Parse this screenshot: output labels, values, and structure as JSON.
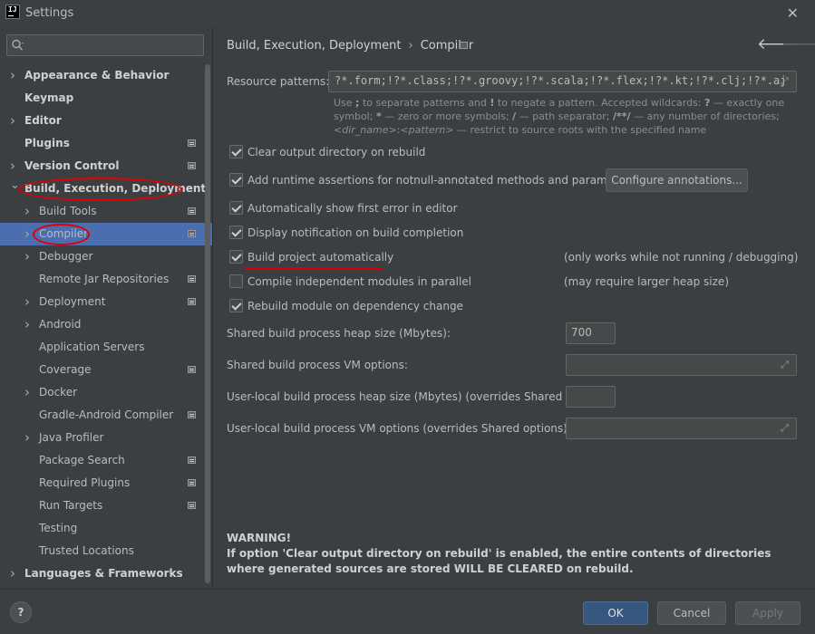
{
  "window": {
    "title": "Settings",
    "logo_text": "IJ"
  },
  "sidebar": {
    "search_placeholder": "",
    "items": [
      {
        "label": "Appearance & Behavior",
        "level": 0,
        "has_children": true,
        "has_icon": false
      },
      {
        "label": "Keymap",
        "level": 0,
        "has_children": false,
        "has_icon": false
      },
      {
        "label": "Editor",
        "level": 0,
        "has_children": true,
        "has_icon": false
      },
      {
        "label": "Plugins",
        "level": 0,
        "has_children": false,
        "has_icon": true
      },
      {
        "label": "Version Control",
        "level": 0,
        "has_children": true,
        "has_icon": true
      },
      {
        "label": "Build, Execution, Deployment",
        "level": 0,
        "has_children": true,
        "expanded": true,
        "has_icon": false
      },
      {
        "label": "Build Tools",
        "level": 1,
        "has_children": true,
        "has_icon": true
      },
      {
        "label": "Compiler",
        "level": 1,
        "has_children": true,
        "has_icon": true,
        "selected": true
      },
      {
        "label": "Debugger",
        "level": 1,
        "has_children": true,
        "has_icon": false
      },
      {
        "label": "Remote Jar Repositories",
        "level": 1,
        "has_children": false,
        "has_icon": true
      },
      {
        "label": "Deployment",
        "level": 1,
        "has_children": true,
        "has_icon": true
      },
      {
        "label": "Android",
        "level": 1,
        "has_children": true,
        "has_icon": false
      },
      {
        "label": "Application Servers",
        "level": 1,
        "has_children": false,
        "has_icon": false
      },
      {
        "label": "Coverage",
        "level": 1,
        "has_children": false,
        "has_icon": true
      },
      {
        "label": "Docker",
        "level": 1,
        "has_children": true,
        "has_icon": false
      },
      {
        "label": "Gradle-Android Compiler",
        "level": 1,
        "has_children": false,
        "has_icon": true
      },
      {
        "label": "Java Profiler",
        "level": 1,
        "has_children": true,
        "has_icon": false
      },
      {
        "label": "Package Search",
        "level": 1,
        "has_children": false,
        "has_icon": true
      },
      {
        "label": "Required Plugins",
        "level": 1,
        "has_children": false,
        "has_icon": true
      },
      {
        "label": "Run Targets",
        "level": 1,
        "has_children": false,
        "has_icon": true
      },
      {
        "label": "Testing",
        "level": 1,
        "has_children": false,
        "has_icon": false
      },
      {
        "label": "Trusted Locations",
        "level": 1,
        "has_children": false,
        "has_icon": false
      },
      {
        "label": "Languages & Frameworks",
        "level": 0,
        "has_children": true,
        "has_icon": false
      }
    ]
  },
  "breadcrumb": {
    "parent": "Build, Execution, Deployment",
    "current": "Compiler"
  },
  "resource_patterns": {
    "label": "Resource patterns:",
    "value": "?*.form;!?*.class;!?*.groovy;!?*.scala;!?*.flex;!?*.kt;!?*.clj;!?*.aj",
    "hint": {
      "p1": "Use ",
      "p2": ";",
      "p3": " to separate patterns and ",
      "p4": "!",
      "p5": " to negate a pattern. Accepted wildcards: ",
      "p6": "?",
      "p7": " — exactly one symbol; ",
      "p8": "*",
      "p9": " — zero or more symbols; ",
      "p10": "/",
      "p11": " — path separator; ",
      "p12": "/**/",
      "p13": " — any number of directories; ",
      "p14": "<dir_name>",
      "p15": ":",
      "p16": "<pattern>",
      "p17": " — restrict to source roots with the specified name"
    }
  },
  "options": {
    "clear_output": {
      "label": "Clear output directory on rebuild",
      "checked": true
    },
    "runtime_assertions": {
      "label": "Add runtime assertions for notnull-annotated methods and parameters",
      "checked": true
    },
    "configure_annotations": "Configure annotations...",
    "show_first_error": {
      "label": "Automatically show first error in editor",
      "checked": true
    },
    "display_notification": {
      "label": "Display notification on build completion",
      "checked": true
    },
    "build_automatically": {
      "label": "Build project automatically",
      "checked": true,
      "note": "(only works while not running / debugging)"
    },
    "compile_parallel": {
      "label": "Compile independent modules in parallel",
      "checked": false,
      "note": "(may require larger heap size)"
    },
    "rebuild_on_change": {
      "label": "Rebuild module on dependency change",
      "checked": true
    }
  },
  "fields": {
    "heap_size": {
      "label": "Shared build process heap size (Mbytes):",
      "value": "700"
    },
    "vm_options": {
      "label": "Shared build process VM options:",
      "value": ""
    },
    "user_heap": {
      "label": "User-local build process heap size (Mbytes) (overrides Shared size):",
      "value": ""
    },
    "user_vm": {
      "label": "User-local build process VM options (overrides Shared options):",
      "value": ""
    }
  },
  "warning": {
    "title": "WARNING!",
    "text": "If option 'Clear output directory on rebuild' is enabled, the entire contents of directories where generated sources are stored WILL BE CLEARED on rebuild."
  },
  "buttons": {
    "help": "?",
    "ok": "OK",
    "cancel": "Cancel",
    "apply": "Apply"
  },
  "colors": {
    "background": "#3c3f41",
    "selection": "#4b6eaf",
    "annotation": "#e00000",
    "ok_button": "#365880"
  },
  "icons": {
    "close": "close-icon",
    "search": "search-icon",
    "back": "back-arrow-icon",
    "forward": "forward-arrow-icon",
    "expand": "expand-icon",
    "chevron": "chevron-right-icon",
    "chevron_open": "chevron-down-icon",
    "project_scope": "project-scope-icon"
  }
}
